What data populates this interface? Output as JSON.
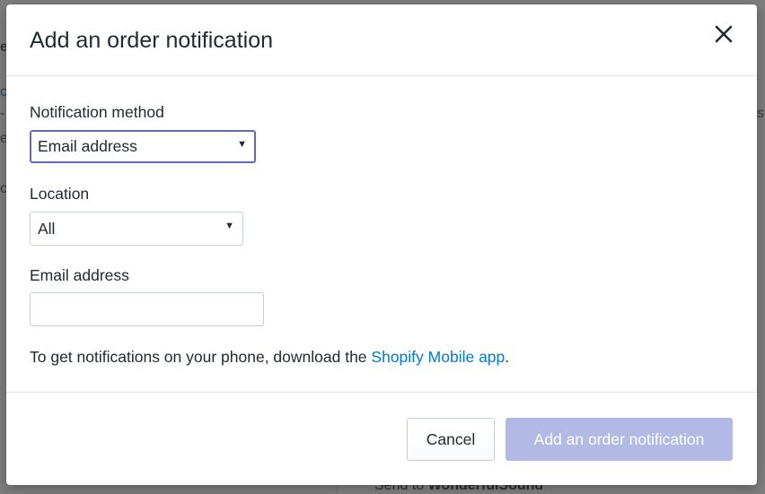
{
  "background": {
    "fragments": [
      "e",
      "c",
      "-",
      "e",
      "c",
      "s"
    ],
    "bottom_prefix": "Send to",
    "bottom_name": "WonderfulSound"
  },
  "modal": {
    "title": "Add an order notification",
    "close_icon": "close-icon",
    "notification_method": {
      "label": "Notification method",
      "selected": "Email address"
    },
    "location": {
      "label": "Location",
      "selected": "All"
    },
    "email": {
      "label": "Email address",
      "value": "",
      "placeholder": ""
    },
    "hint": {
      "text": "To get notifications on your phone, download the",
      "link": "Shopify Mobile app",
      "suffix": "."
    },
    "footer": {
      "cancel_label": "Cancel",
      "submit_label": "Add an order notification"
    }
  },
  "colors": {
    "primary_disabled": "#b3b9e5",
    "link": "#007ace",
    "focus": "#5c6ac4"
  }
}
